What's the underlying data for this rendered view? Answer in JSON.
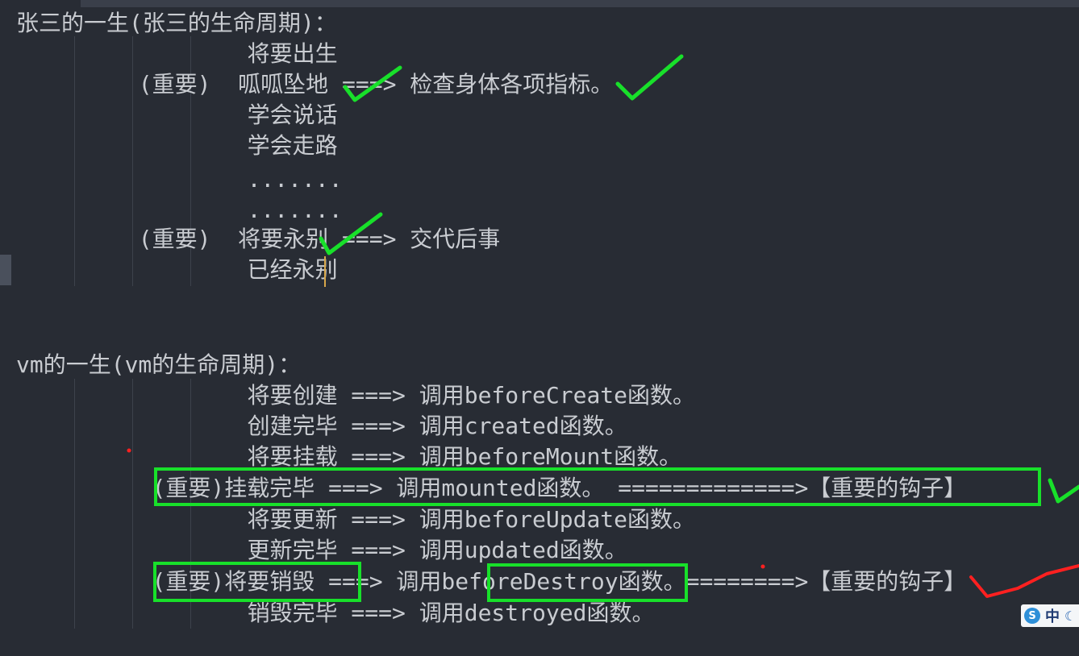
{
  "colors": {
    "background": "#282c34",
    "text": "#c9ccd1",
    "annotation_green": "#18e02a",
    "annotation_red": "#ff2020",
    "cursor": "#d7a64a"
  },
  "section_person": {
    "heading": "张三的一生(张三的生命周期)：",
    "lines": [
      "                 将要出生",
      "         (重要)  呱呱坠地 ===> 检查身体各项指标。",
      "                 学会说话",
      "                 学会走路",
      "                 .......",
      "                 .......",
      "         (重要)  将要永别 ===> 交代后事",
      "                 已经永别"
    ]
  },
  "section_vm": {
    "heading": "vm的一生(vm的生命周期)：",
    "lines": [
      "                 将要创建 ===> 调用beforeCreate函数。",
      "                 创建完毕 ===> 调用created函数。",
      "                 将要挂载 ===> 调用beforeMount函数。",
      "          (重要)挂载完毕 ===> 调用mounted函数。 =============>【重要的钩子】",
      "                 将要更新 ===> 调用beforeUpdate函数。",
      "                 更新完毕 ===> 调用updated函数。",
      "          (重要)将要销毁 ===> 调用beforeDestroy函数。========>【重要的钩子】",
      "                 销毁完毕 ===> 调用destroyed函数。"
    ]
  },
  "ime_indicator": {
    "logo_icon": "sogou-logo-icon",
    "language": "中",
    "mode_icon": "moon-icon"
  }
}
